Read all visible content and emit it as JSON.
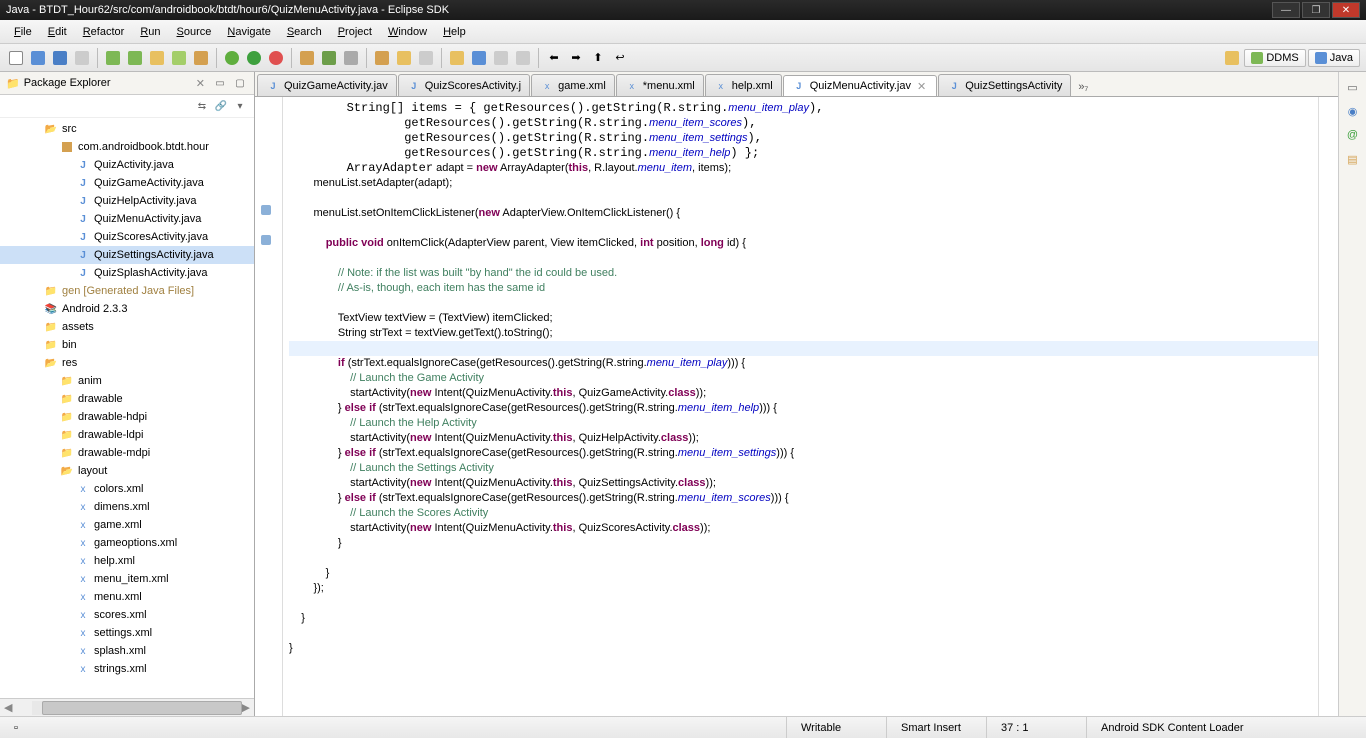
{
  "window": {
    "title": "Java - BTDT_Hour62/src/com/androidbook/btdt/hour6/QuizMenuActivity.java - Eclipse SDK"
  },
  "menubar": [
    "File",
    "Edit",
    "Refactor",
    "Run",
    "Source",
    "Navigate",
    "Search",
    "Project",
    "Window",
    "Help"
  ],
  "perspectives": [
    {
      "icon": "ddms-icon",
      "label": "DDMS"
    },
    {
      "icon": "java-icon",
      "label": "Java"
    }
  ],
  "packageExplorer": {
    "title": "Package Explorer",
    "tree": [
      {
        "indent": 1,
        "icon": "folder-src",
        "label": "src",
        "kind": "folder"
      },
      {
        "indent": 2,
        "icon": "package",
        "label": "com.androidbook.btdt.hour",
        "kind": "package"
      },
      {
        "indent": 3,
        "icon": "java",
        "label": "QuizActivity.java",
        "kind": "java"
      },
      {
        "indent": 3,
        "icon": "java",
        "label": "QuizGameActivity.java",
        "kind": "java"
      },
      {
        "indent": 3,
        "icon": "java",
        "label": "QuizHelpActivity.java",
        "kind": "java"
      },
      {
        "indent": 3,
        "icon": "java",
        "label": "QuizMenuActivity.java",
        "kind": "java"
      },
      {
        "indent": 3,
        "icon": "java",
        "label": "QuizScoresActivity.java",
        "kind": "java"
      },
      {
        "indent": 3,
        "icon": "java",
        "label": "QuizSettingsActivity.java",
        "kind": "java",
        "selected": true
      },
      {
        "indent": 3,
        "icon": "java",
        "label": "QuizSplashActivity.java",
        "kind": "java"
      },
      {
        "indent": 1,
        "icon": "folder-gen",
        "label": "gen [Generated Java Files]",
        "kind": "gen"
      },
      {
        "indent": 1,
        "icon": "library",
        "label": "Android 2.3.3",
        "kind": "lib"
      },
      {
        "indent": 1,
        "icon": "folder",
        "label": "assets",
        "kind": "folder"
      },
      {
        "indent": 1,
        "icon": "folder",
        "label": "bin",
        "kind": "folder"
      },
      {
        "indent": 1,
        "icon": "folder-open",
        "label": "res",
        "kind": "folder"
      },
      {
        "indent": 2,
        "icon": "folder",
        "label": "anim",
        "kind": "folder"
      },
      {
        "indent": 2,
        "icon": "folder",
        "label": "drawable",
        "kind": "folder"
      },
      {
        "indent": 2,
        "icon": "folder",
        "label": "drawable-hdpi",
        "kind": "folder"
      },
      {
        "indent": 2,
        "icon": "folder",
        "label": "drawable-ldpi",
        "kind": "folder"
      },
      {
        "indent": 2,
        "icon": "folder",
        "label": "drawable-mdpi",
        "kind": "folder"
      },
      {
        "indent": 2,
        "icon": "folder-open",
        "label": "layout",
        "kind": "folder"
      },
      {
        "indent": 3,
        "icon": "xml",
        "label": "colors.xml",
        "kind": "xml"
      },
      {
        "indent": 3,
        "icon": "xml",
        "label": "dimens.xml",
        "kind": "xml"
      },
      {
        "indent": 3,
        "icon": "xml",
        "label": "game.xml",
        "kind": "xml"
      },
      {
        "indent": 3,
        "icon": "xml",
        "label": "gameoptions.xml",
        "kind": "xml"
      },
      {
        "indent": 3,
        "icon": "xml",
        "label": "help.xml",
        "kind": "xml"
      },
      {
        "indent": 3,
        "icon": "xml",
        "label": "menu_item.xml",
        "kind": "xml"
      },
      {
        "indent": 3,
        "icon": "xml",
        "label": "menu.xml",
        "kind": "xml"
      },
      {
        "indent": 3,
        "icon": "xml",
        "label": "scores.xml",
        "kind": "xml"
      },
      {
        "indent": 3,
        "icon": "xml",
        "label": "settings.xml",
        "kind": "xml"
      },
      {
        "indent": 3,
        "icon": "xml",
        "label": "splash.xml",
        "kind": "xml"
      },
      {
        "indent": 3,
        "icon": "xml",
        "label": "strings.xml",
        "kind": "xml"
      }
    ]
  },
  "editorTabs": [
    {
      "icon": "java",
      "label": "QuizGameActivity.jav"
    },
    {
      "icon": "java",
      "label": "QuizScoresActivity.j"
    },
    {
      "icon": "xml",
      "label": "game.xml"
    },
    {
      "icon": "xml",
      "label": "*menu.xml"
    },
    {
      "icon": "xml",
      "label": "help.xml"
    },
    {
      "icon": "java",
      "label": "QuizMenuActivity.jav",
      "active": true,
      "closable": true
    },
    {
      "icon": "java",
      "label": "QuizSettingsActivity"
    }
  ],
  "editorMore": "»₇",
  "codeLines": [
    {
      "t": "        String[] items = { getResources().getString(R.string.",
      "i": "menu_item_play",
      "r": "),"
    },
    {
      "t": "                getResources().getString(R.string.",
      "i": "menu_item_scores",
      "r": "),"
    },
    {
      "t": "                getResources().getString(R.string.",
      "i": "menu_item_settings",
      "r": "),"
    },
    {
      "t": "                getResources().getString(R.string.",
      "i": "menu_item_help",
      "r": ") };"
    },
    {
      "raw": "        ArrayAdapter<String> adapt = <kw>new</kw> ArrayAdapter<String>(<kw>this</kw>, R.layout.<it>menu_item</it>, items);"
    },
    {
      "raw": "        menuList.setAdapter(adapt);"
    },
    {
      "raw": ""
    },
    {
      "raw": "        menuList.setOnItemClickListener(<kw>new</kw> AdapterView.OnItemClickListener() {"
    },
    {
      "raw": ""
    },
    {
      "raw": "            <kw>public void</kw> onItemClick(AdapterView<?> parent, View itemClicked, <kw>int</kw> position, <kw>long</kw> id) {"
    },
    {
      "raw": ""
    },
    {
      "cm": "                // Note: if the list was built \"by hand\" the id could be used."
    },
    {
      "cm": "                // As-is, though, each item has the same id"
    },
    {
      "raw": ""
    },
    {
      "raw": "                TextView textView = (TextView) itemClicked;"
    },
    {
      "raw": "                String strText = textView.getText().toString();"
    },
    {
      "raw": "",
      "hl": true
    },
    {
      "raw": "                <kw>if</kw> (strText.equalsIgnoreCase(getResources().getString(R.string.<it>menu_item_play</it>))) {"
    },
    {
      "cm": "                    // Launch the Game Activity"
    },
    {
      "raw": "                    startActivity(<kw>new</kw> Intent(QuizMenuActivity.<kw>this</kw>, QuizGameActivity.<kw>class</kw>));"
    },
    {
      "raw": "                } <kw>else if</kw> (strText.equalsIgnoreCase(getResources().getString(R.string.<it>menu_item_help</it>))) {"
    },
    {
      "cm": "                    // Launch the Help Activity"
    },
    {
      "raw": "                    startActivity(<kw>new</kw> Intent(QuizMenuActivity.<kw>this</kw>, QuizHelpActivity.<kw>class</kw>));"
    },
    {
      "raw": "                } <kw>else if</kw> (strText.equalsIgnoreCase(getResources().getString(R.string.<it>menu_item_settings</it>))) {"
    },
    {
      "cm": "                    // Launch the Settings Activity"
    },
    {
      "raw": "                    startActivity(<kw>new</kw> Intent(QuizMenuActivity.<kw>this</kw>, QuizSettingsActivity.<kw>class</kw>));"
    },
    {
      "raw": "                } <kw>else if</kw> (strText.equalsIgnoreCase(getResources().getString(R.string.<it>menu_item_scores</it>))) {"
    },
    {
      "cm": "                    // Launch the Scores Activity"
    },
    {
      "raw": "                    startActivity(<kw>new</kw> Intent(QuizMenuActivity.<kw>this</kw>, QuizScoresActivity.<kw>class</kw>));"
    },
    {
      "raw": "                }"
    },
    {
      "raw": ""
    },
    {
      "raw": "            }"
    },
    {
      "raw": "        });"
    },
    {
      "raw": ""
    },
    {
      "raw": "    }"
    },
    {
      "raw": ""
    },
    {
      "raw": "}"
    }
  ],
  "status": {
    "writable": "Writable",
    "insert": "Smart Insert",
    "cursor": "37 : 1",
    "task": "Android SDK Content Loader"
  }
}
